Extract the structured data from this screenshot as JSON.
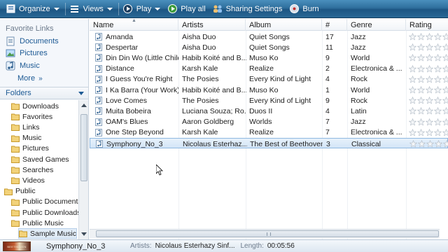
{
  "toolbar": {
    "organize": "Organize",
    "views": "Views",
    "play": "Play",
    "play_all": "Play all",
    "sharing": "Sharing Settings",
    "burn": "Burn"
  },
  "sidebar": {
    "favorite_links_title": "Favorite Links",
    "favorites": [
      "Documents",
      "Pictures",
      "Music"
    ],
    "more": "More",
    "folders_title": "Folders",
    "tree": [
      {
        "label": "Downloads",
        "indent": 1
      },
      {
        "label": "Favorites",
        "indent": 1
      },
      {
        "label": "Links",
        "indent": 1
      },
      {
        "label": "Music",
        "indent": 1
      },
      {
        "label": "Pictures",
        "indent": 1
      },
      {
        "label": "Saved Games",
        "indent": 1
      },
      {
        "label": "Searches",
        "indent": 1
      },
      {
        "label": "Videos",
        "indent": 1
      },
      {
        "label": "Public",
        "indent": 0
      },
      {
        "label": "Public Documents",
        "indent": 1
      },
      {
        "label": "Public Downloads",
        "indent": 1
      },
      {
        "label": "Public Music",
        "indent": 1
      },
      {
        "label": "Sample Music",
        "indent": 2
      }
    ]
  },
  "columns": [
    "Name",
    "Artists",
    "Album",
    "#",
    "Genre",
    "Rating"
  ],
  "rows": [
    {
      "name": "Amanda",
      "artist": "Aisha Duo",
      "album": "Quiet Songs",
      "num": "17",
      "genre": "Jazz"
    },
    {
      "name": "Despertar",
      "artist": "Aisha Duo",
      "album": "Quiet Songs",
      "num": "11",
      "genre": "Jazz"
    },
    {
      "name": "Din Din Wo (Little Child)",
      "artist": "Habib Koité and B...",
      "album": "Muso Ko",
      "num": "9",
      "genre": "World"
    },
    {
      "name": "Distance",
      "artist": "Karsh Kale",
      "album": "Realize",
      "num": "2",
      "genre": "Electronica & ..."
    },
    {
      "name": "I Guess You're Right",
      "artist": "The Posies",
      "album": "Every Kind of Light",
      "num": "4",
      "genre": "Rock"
    },
    {
      "name": "I Ka Barra (Your Work)",
      "artist": "Habib Koité and B...",
      "album": "Muso Ko",
      "num": "1",
      "genre": "World"
    },
    {
      "name": "Love Comes",
      "artist": "The Posies",
      "album": "Every Kind of Light",
      "num": "9",
      "genre": "Rock"
    },
    {
      "name": "Muita Bobeira",
      "artist": "Luciana Souza; Ro...",
      "album": "Duos II",
      "num": "4",
      "genre": "Latin"
    },
    {
      "name": "OAM's Blues",
      "artist": "Aaron Goldberg",
      "album": "Worlds",
      "num": "7",
      "genre": "Jazz"
    },
    {
      "name": "One Step Beyond",
      "artist": "Karsh Kale",
      "album": "Realize",
      "num": "7",
      "genre": "Electronica & ..."
    },
    {
      "name": "Symphony_No_3",
      "artist": "Nicolaus Esterhaz...",
      "album": "The Best of Beethoven",
      "num": "3",
      "genre": "Classical"
    }
  ],
  "selected_row": 10,
  "details": {
    "title": "Symphony_No_3",
    "artists_label": "Artists:",
    "artists_value": "Nicolaus Esterhazy Sinf...",
    "length_label": "Length:",
    "length_value": "00:05:56",
    "album_art_text": "BEETHOVEN"
  }
}
